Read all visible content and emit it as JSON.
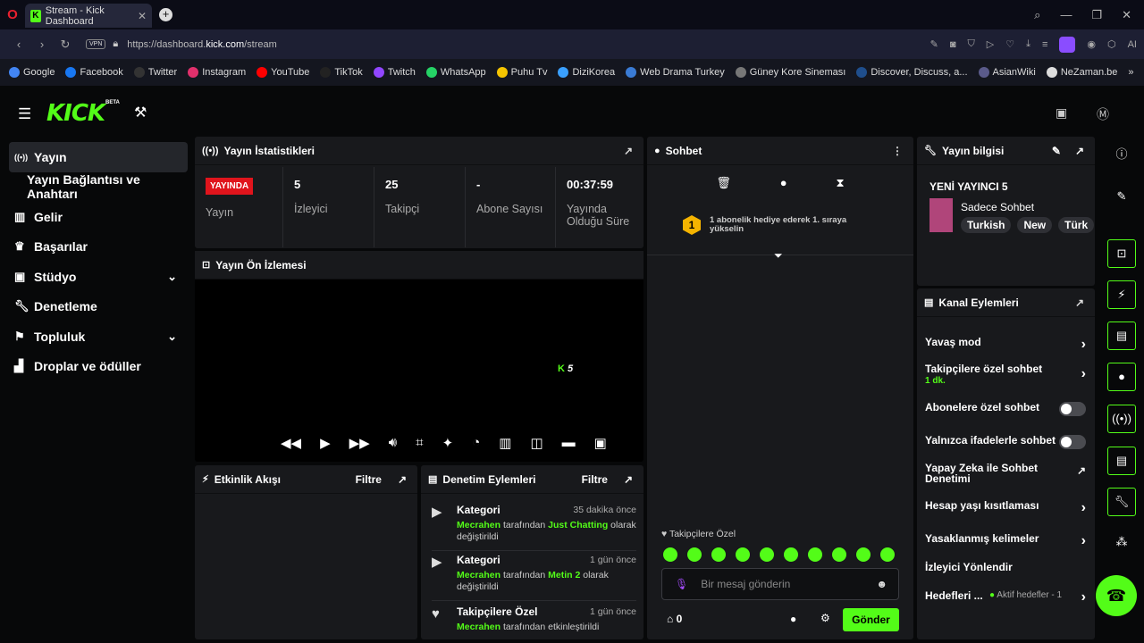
{
  "browser": {
    "tab_title": "Stream - Kick Dashboard",
    "tab_favicon": "K",
    "url_prefix": "https://dashboard.",
    "url_domain": "kick.com",
    "url_path": "/stream",
    "vpn": "VPN",
    "ai_label": "AI"
  },
  "bookmarks": [
    {
      "label": "Google",
      "icon": "google-icon",
      "color": "#4285f4"
    },
    {
      "label": "Facebook",
      "icon": "facebook-icon",
      "color": "#1877f2"
    },
    {
      "label": "Twitter",
      "icon": "twitter-icon",
      "color": "#333333"
    },
    {
      "label": "Instagram",
      "icon": "instagram-icon",
      "color": "#e1306c"
    },
    {
      "label": "YouTube",
      "icon": "youtube-icon",
      "color": "#ff0000"
    },
    {
      "label": "TikTok",
      "icon": "tiktok-icon",
      "color": "#222222"
    },
    {
      "label": "Twitch",
      "icon": "twitch-icon",
      "color": "#9146ff"
    },
    {
      "label": "WhatsApp",
      "icon": "whatsapp-icon",
      "color": "#25d366"
    },
    {
      "label": "Puhu Tv",
      "icon": "puhutv-icon",
      "color": "#f5c400"
    },
    {
      "label": "DiziKorea",
      "icon": "dizikorea-icon",
      "color": "#3aa0ff"
    },
    {
      "label": "Web Drama Turkey",
      "icon": "webdrama-icon",
      "color": "#3a7bd5"
    },
    {
      "label": "Güney Kore Sineması",
      "icon": "film-icon",
      "color": "#777777"
    },
    {
      "label": "Discover, Discuss, a...",
      "icon": "mdl-icon",
      "color": "#1f4e8c"
    },
    {
      "label": "AsianWiki",
      "icon": "asianwiki-icon",
      "color": "#5a5a8a"
    },
    {
      "label": "NeZaman.be",
      "icon": "nezaman-icon",
      "color": "#dddddd"
    }
  ],
  "header": {
    "logo": "KICK",
    "beta": "BETA"
  },
  "sidebar": {
    "items": [
      {
        "label": "Yayın",
        "icon": "broadcast-icon",
        "active": true
      },
      {
        "label": "Yayın Bağlantısı ve Anahtarı",
        "icon": ""
      },
      {
        "label": "Gelir",
        "icon": "revenue-icon"
      },
      {
        "label": "Başarılar",
        "icon": "trophy-icon"
      },
      {
        "label": "Stüdyo",
        "icon": "studio-icon",
        "chevron": true
      },
      {
        "label": "Denetleme",
        "icon": "wrench-icon"
      },
      {
        "label": "Topluluk",
        "icon": "community-icon",
        "chevron": true
      },
      {
        "label": "Droplar ve ödüller",
        "icon": "drops-icon"
      }
    ]
  },
  "stats": {
    "title": "Yayın İstatistikleri",
    "live": "YAYINDA",
    "live_label": "Yayın",
    "items": [
      {
        "value": "5",
        "label": "İzleyici"
      },
      {
        "value": "25",
        "label": "Takipçi"
      },
      {
        "value": "-",
        "label": "Abone Sayısı"
      },
      {
        "value": "00:37:59",
        "label": "Yayında Olduğu Süre"
      }
    ]
  },
  "preview": {
    "title": "Yayın Ön İzlemesi",
    "overlay": "5"
  },
  "activity": {
    "title": "Etkinlik Akışı",
    "filter": "Filtre"
  },
  "moderation": {
    "title": "Denetim Eylemleri",
    "filter": "Filtre",
    "items": [
      {
        "title": "Kategori",
        "time": "35 dakika önce",
        "user": "Mecrahen",
        "mid": " tarafından ",
        "target": "Just Chatting",
        "rest": " olarak değiştirildi"
      },
      {
        "title": "Kategori",
        "time": "1 gün önce",
        "user": "Mecrahen",
        "mid": " tarafından ",
        "target": "Metin 2",
        "rest": " olarak değiştirildi"
      },
      {
        "title": "Takipçilere Özel",
        "time": "1 gün önce",
        "user": "Mecrahen",
        "mid": " tarafından etkinleştirildi",
        "target": "",
        "rest": ""
      }
    ]
  },
  "chat": {
    "title": "Sohbet",
    "gift_badge": "1",
    "gift_text": "1 abonelik hediye ederek 1. sıraya yükselin",
    "followers_only": "Takipçilere Özel",
    "placeholder": "Bir mesaj gönderin",
    "count": "0",
    "send": "Gönder"
  },
  "info": {
    "title": "Yayın bilgisi",
    "stream_title": "YENİ YAYINCI 5",
    "category": "Sadece Sohbet",
    "tags": [
      "Turkish",
      "New",
      "Türk"
    ]
  },
  "channel": {
    "title": "Kanal Eylemleri",
    "items": [
      {
        "label": "Yavaş mod",
        "kind": "arrow"
      },
      {
        "label": "Takipçilere özel sohbet",
        "sub": "1 dk.",
        "kind": "arrow"
      },
      {
        "label": "Abonelere özel sohbet",
        "kind": "toggle"
      },
      {
        "label": "Yalnızca ifadelerle sohbet",
        "kind": "toggle"
      },
      {
        "label": "Yapay Zeka ile Sohbet Denetimi",
        "kind": "external"
      },
      {
        "label": "Hesap yaşı kısıtlaması",
        "kind": "arrow"
      },
      {
        "label": "Yasaklanmış kelimeler",
        "kind": "arrow"
      },
      {
        "label": "İzleyici Yönlendir",
        "kind": "none"
      },
      {
        "label": "Hedefleri ...",
        "sub": "Aktif hedefler - 1",
        "kind": "arrow"
      }
    ]
  },
  "colors": {
    "accent": "#53fc18",
    "live": "#e0141c",
    "panel": "#18191c"
  }
}
